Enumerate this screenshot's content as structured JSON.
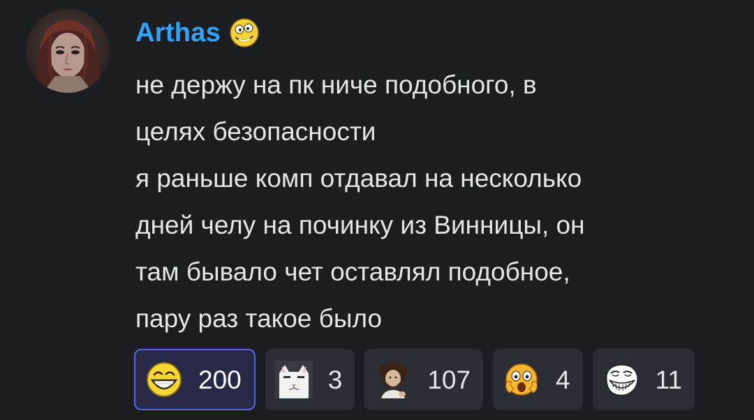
{
  "message": {
    "author": "Arthas",
    "author_color": "#2ea4ff",
    "author_badge_icon": "derpy-smile-emoji-icon",
    "body_lines": [
      "не держу на пк ниче подобного, в",
      "целях безопасности",
      "я раньше комп отдавал на несколько",
      "дней челу на починку из Винницы, он",
      "там бывало чет оставлял подобное,",
      "пару раз такое было"
    ]
  },
  "reactions": [
    {
      "icon": "grin-smile-emoji-icon",
      "count": "200",
      "active": true
    },
    {
      "icon": "white-cat-emoji-icon",
      "count": "3",
      "active": false
    },
    {
      "icon": "bob-ross-emoji-icon",
      "count": "107",
      "active": false
    },
    {
      "icon": "shocked-face-emoji-icon",
      "count": "4",
      "active": false
    },
    {
      "icon": "trollface-emoji-icon",
      "count": "11",
      "active": false
    }
  ],
  "colors": {
    "background": "#1c1d21",
    "reaction_bg": "#2c2d33",
    "reaction_active_bg": "#262a46",
    "reaction_active_border": "#5965f0",
    "text": "#e6e6e8"
  }
}
